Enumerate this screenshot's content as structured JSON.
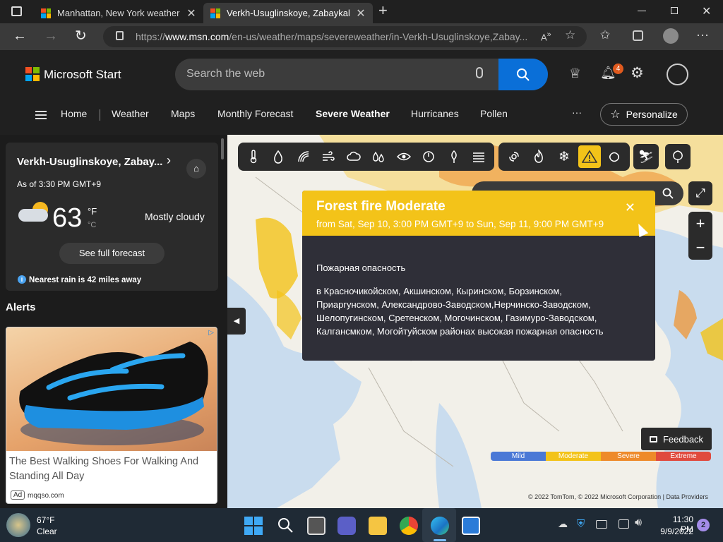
{
  "browser": {
    "tabs": [
      {
        "title": "Manhattan, New York weather fo",
        "active": false
      },
      {
        "title": "Verkh-Usuglinskoye, Zabaykalsky",
        "active": true
      }
    ],
    "url_prefix": "https://",
    "url_domain": "www.msn.com",
    "url_path": "/en-us/weather/maps/severeweather/in-Verkh-Usuglinskoye,Zabay..."
  },
  "header": {
    "brand": "Microsoft Start",
    "search_placeholder": "Search the web",
    "notification_count": "4",
    "nav": [
      "Home",
      "Weather",
      "Maps",
      "Monthly Forecast",
      "Severe Weather",
      "Hurricanes",
      "Pollen"
    ],
    "more": "···",
    "personalize": "Personalize"
  },
  "weather_card": {
    "location": "Verkh-Usuglinskoye, Zabay...",
    "as_of": "As of 3:30 PM GMT+9",
    "temperature": "63",
    "unit_f": "°F",
    "unit_c": "°C",
    "condition": "Mostly cloudy",
    "forecast_button": "See full forecast",
    "rain_note": "Nearest rain is 42 miles away"
  },
  "alerts_heading": "Alerts",
  "ad": {
    "title": "The Best Walking Shoes For Walking And Standing All Day",
    "badge": "Ad",
    "source": "mqqso.com"
  },
  "popup": {
    "title": "Forest fire Moderate",
    "subtitle": "from Sat, Sep 10, 3:00 PM GMT+9 to Sun, Sep 11, 9:00 PM GMT+9",
    "heading": "Пожарная опасность",
    "line1": "в Красночикойском, Акшинском, Кыринском, Борзинском,",
    "line2": "Приаргунском, Александрово-Заводском,Нерчинско-Заводском,",
    "line3": "Шелопугинском, Сретенском, Могочинском, Газимуро-Заводском,",
    "line4": "Калгансмком, Могойтуйском районах высокая пожарная опасность"
  },
  "feedback": "Feedback",
  "legend": [
    {
      "label": "Mild",
      "color": "#4a78d6"
    },
    {
      "label": "Moderate",
      "color": "#f3c319"
    },
    {
      "label": "Severe",
      "color": "#ee8a2a"
    },
    {
      "label": "Extreme",
      "color": "#e04a3e"
    }
  ],
  "copyright": "© 2022 TomTom, © 2022 Microsoft Corporation | Data Providers",
  "taskbar": {
    "weather_temp": "67°F",
    "weather_cond": "Clear",
    "time": "11:30 PM",
    "date": "9/9/2022",
    "notif_count": "2"
  },
  "colors": {
    "accent": "#0a6fd8",
    "alert_yellow": "#f3c319"
  }
}
